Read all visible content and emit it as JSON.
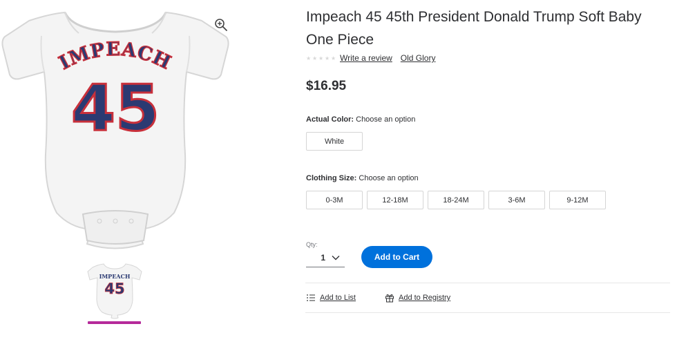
{
  "product": {
    "title": "Impeach 45 45th President Donald Trump Soft Baby One Piece",
    "rating_count_stars": 5,
    "write_review": "Write a review",
    "brand": "Old Glory",
    "price": "$16.95",
    "image_text": {
      "word": "IMPEACH",
      "number": "45"
    }
  },
  "options": {
    "color": {
      "label": "Actual Color:",
      "prompt": "Choose an option",
      "values": [
        "White"
      ]
    },
    "size": {
      "label": "Clothing Size:",
      "prompt": "Choose an option",
      "values": [
        "0-3M",
        "12-18M",
        "18-24M",
        "3-6M",
        "9-12M"
      ]
    }
  },
  "qty": {
    "label": "Qty:",
    "value": "1"
  },
  "buttons": {
    "add_to_cart": "Add to Cart"
  },
  "actions": {
    "add_to_list": "Add to List",
    "add_to_registry": "Add to Registry"
  },
  "colors": {
    "accent": "#0071dc",
    "thumb_underline": "#b52a9a",
    "print_navy": "#2b3a72",
    "print_red": "#c8303b"
  }
}
